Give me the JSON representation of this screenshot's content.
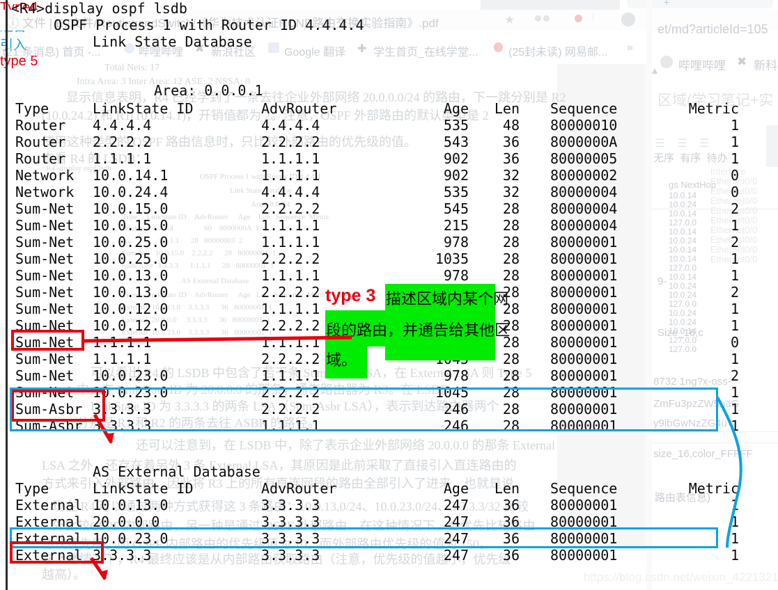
{
  "console": {
    "prompt_line": "<R4>display ospf lsdb",
    "title1": "OSPF Process 1 with Router ID 4.4.4.4",
    "title2": "Link State Database",
    "area_line": "Area: 0.0.0.1",
    "external_title": "AS External Database",
    "headers": [
      "Type",
      "LinkState ID",
      "AdvRouter",
      "Age",
      "Len",
      "Sequence",
      "Metric"
    ],
    "area_rows": [
      {
        "type": "Router",
        "lsid": "4.4.4.4",
        "adv": "4.4.4.4",
        "age": "535",
        "len": "48",
        "seq": "80000010",
        "metric": "1"
      },
      {
        "type": "Router",
        "lsid": "2.2.2.2",
        "adv": "2.2.2.2",
        "age": "543",
        "len": "36",
        "seq": "8000000A",
        "metric": "1"
      },
      {
        "type": "Router",
        "lsid": "1.1.1.1",
        "adv": "1.1.1.1",
        "age": "902",
        "len": "36",
        "seq": "80000005",
        "metric": "1"
      },
      {
        "type": "Network",
        "lsid": "10.0.14.1",
        "adv": "1.1.1.1",
        "age": "902",
        "len": "32",
        "seq": "80000002",
        "metric": "0"
      },
      {
        "type": "Network",
        "lsid": "10.0.24.4",
        "adv": "4.4.4.4",
        "age": "535",
        "len": "32",
        "seq": "80000004",
        "metric": "0"
      },
      {
        "type": "Sum-Net",
        "lsid": "10.0.15.0",
        "adv": "2.2.2.2",
        "age": "545",
        "len": "28",
        "seq": "80000004",
        "metric": "2"
      },
      {
        "type": "Sum-Net",
        "lsid": "10.0.15.0",
        "adv": "1.1.1.1",
        "age": "215",
        "len": "28",
        "seq": "80000004",
        "metric": "1"
      },
      {
        "type": "Sum-Net",
        "lsid": "10.0.25.0",
        "adv": "1.1.1.1",
        "age": "978",
        "len": "28",
        "seq": "80000001",
        "metric": "2"
      },
      {
        "type": "Sum-Net",
        "lsid": "10.0.25.0",
        "adv": "2.2.2.2",
        "age": "1035",
        "len": "28",
        "seq": "80000001",
        "metric": "1"
      },
      {
        "type": "Sum-Net",
        "lsid": "10.0.13.0",
        "adv": "1.1.1.1",
        "age": "978",
        "len": "28",
        "seq": "80000001",
        "metric": "1"
      },
      {
        "type": "Sum-Net",
        "lsid": "10.0.13.0",
        "adv": "2.2.2.2",
        "age": "",
        "len": "28",
        "seq": "80000001",
        "metric": "2"
      },
      {
        "type": "Sum-Net",
        "lsid": "10.0.12.0",
        "adv": "1.1.1.1",
        "age": "",
        "len": "28",
        "seq": "80000001",
        "metric": "1"
      },
      {
        "type": "Sum-Net",
        "lsid": "10.0.12.0",
        "adv": "2.2.2.2",
        "age": "",
        "len": "28",
        "seq": "80000001",
        "metric": "1"
      },
      {
        "type": "Sum-Net",
        "lsid": "1.1.1.1",
        "adv": "1.1.1.1",
        "age": "",
        "len": "28",
        "seq": "80000001",
        "metric": "0"
      },
      {
        "type": "Sum-Net",
        "lsid": "1.1.1.1",
        "adv": "2.2.2.2",
        "age": "1045",
        "len": "28",
        "seq": "80000001",
        "metric": "1"
      },
      {
        "type": "Sum-Net",
        "lsid": "10.0.23.0",
        "adv": "1.1.1.1",
        "age": "978",
        "len": "28",
        "seq": "80000001",
        "metric": "2"
      },
      {
        "type": "Sum-Net",
        "lsid": "10.0.23.0",
        "adv": "2.2.2.2",
        "age": "1045",
        "len": "28",
        "seq": "80000001",
        "metric": "1"
      },
      {
        "type": "Sum-Asbr",
        "lsid": "3.3.3.3",
        "adv": "2.2.2.2",
        "age": "246",
        "len": "28",
        "seq": "80000001",
        "metric": "1"
      },
      {
        "type": "Sum-Asbr",
        "lsid": "3.3.3.3",
        "adv": "1.1.1.1",
        "age": "246",
        "len": "28",
        "seq": "80000001",
        "metric": "1"
      }
    ],
    "external_rows": [
      {
        "type": "External",
        "lsid": "10.0.13.0",
        "adv": "3.3.3.3",
        "age": "247",
        "len": "36",
        "seq": "80000001",
        "metric": "1"
      },
      {
        "type": "External",
        "lsid": "20.0.0.0",
        "adv": "3.3.3.3",
        "age": "247",
        "len": "36",
        "seq": "80000001",
        "metric": "1"
      },
      {
        "type": "External",
        "lsid": "10.0.23.0",
        "adv": "3.3.3.3",
        "age": "247",
        "len": "36",
        "seq": "80000001",
        "metric": "1"
      },
      {
        "type": "External",
        "lsid": "3.3.3.3",
        "adv": "3.3.3.3",
        "age": "247",
        "len": "36",
        "seq": "80000001",
        "metric": "1"
      }
    ]
  },
  "annotations": {
    "type3_label": "type 3",
    "type3_note_line1": "描述区域内某个网",
    "type3_note_line2": "段的路由，并通告给其他区",
    "type3_note_line3": "域。",
    "type4_label": "Type4",
    "type5_label": "type 5",
    "notify_label": "通告",
    "import_label": "引入",
    "colors": {
      "red": "#e8000d",
      "blue": "#0aa3e0",
      "green": "#00ec00"
    }
  },
  "background": {
    "address_bar": "文件 | E:/文件/RoutingandSwitch/《华为技术认证HCNP路由交换实验指南》.pdf",
    "bookmarks": [
      "(21 条消息) 首页 -...",
      "哔哩哔哩",
      "新浪社区",
      "Google 翻译",
      "学生首页_在线学堂...",
      "(25封未读) 网易邮..."
    ],
    "url_fragment": "et/md?articleId=105",
    "right_nav": [
      "哔哩哔哩",
      "新科"
    ],
    "doc_title_fragment": "区域(学习笔记+实",
    "toolbar_items": [
      "无序",
      "有序",
      "待办"
    ],
    "stats_total": "Total Nets: 17",
    "stats_detail": "Intra Area: 3    Inter Area: 12    ASE: 2    NSSA: 0",
    "para1": "显示信息表明，R4 已经学到了一条去往企业外部网络 20.0.0.0/24 的路由，下一跳分别是 R2",
    "para2": "(10.0.24.2) 和 R1(10.0.14.1)，开销值都为 2。注意，OSPF 外部路由的默认类型是 2",
    "para3": "使用这种类型的 OSPF 路由信息时，只比较外部路由的优先级的值。",
    "para4": "查看 R4 的 LSDB：",
    "para_cmd": "<R4>display ospf lsdb",
    "para5": "可以看出 R4 的 LSDB 中包含了若干条 Sum-Asbr LSA，在 External LSA 则 Type 5",
    "para6": "中，在 LinkState ID 为 20.0.0.0 的那条，通告路由器为 R3。在 LSDB",
    "para7": "LinkState ID 为 3.3.3.3 的两条 LSA（Sum-Asbr LSA），表示到达路由器两个",
    "para8": "分别是 R1 和 R2 的两条去往 ASBR 的路径。",
    "para9": "还可以注意到，在 LSDB 中，除了表示企业外部网络 20.0.0.0 的那条 External",
    "para10": "LSA 之外，还存在着另外 3 条 External LSA，其原因是此前采取了直接引入直连路由的",
    "para11": "方式来引入外部路由，因此将 R3 上的所有直连网段的路由全部引入了进来，也就是说，",
    "para12": "现在 R4 可以通过两种方式获得这 3 条路由：10.0.13.0/24、10.0.23.0/24、3.3.3.3/32 比较",
    "para13": "外比较OSPF 内部路由，另一种是通过 OSPF 外部路由。在这种情况下，会优先比较路由",
    "para14": "协议优先级，而 OSPF 内部路由的优先级值为 10，而外部路由优先级的值为 150。",
    "para15": "在上述情况下，R4 最终应该是从内部路由获取路由（注意，优先级的值越小，优先级",
    "para16": "越高）。",
    "watermark": "https://blog.csdn.net/weixin_42213219"
  }
}
